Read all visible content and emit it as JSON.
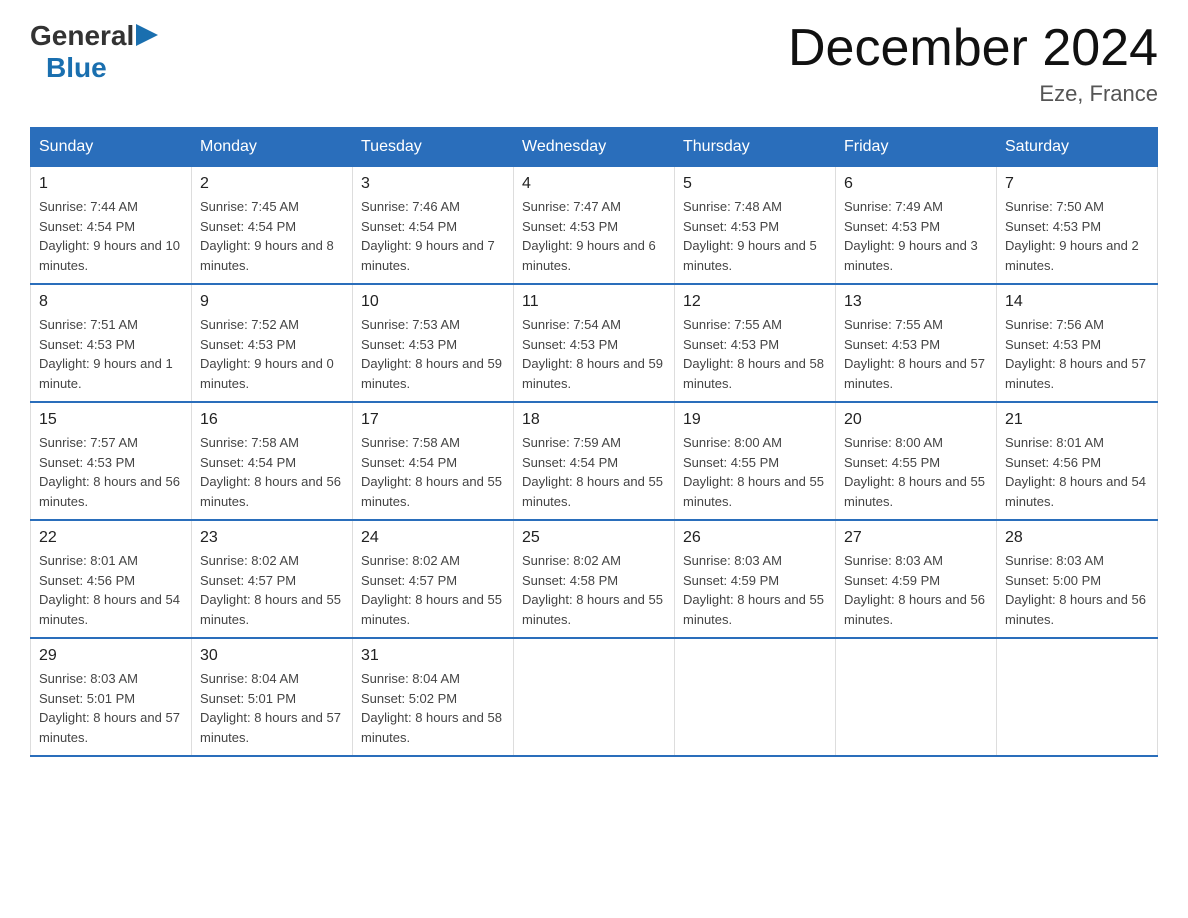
{
  "header": {
    "logo_text_general": "General",
    "logo_text_blue": "Blue",
    "month_title": "December 2024",
    "location": "Eze, France"
  },
  "weekdays": [
    "Sunday",
    "Monday",
    "Tuesday",
    "Wednesday",
    "Thursday",
    "Friday",
    "Saturday"
  ],
  "weeks": [
    [
      {
        "day": "1",
        "sunrise": "7:44 AM",
        "sunset": "4:54 PM",
        "daylight": "9 hours and 10 minutes."
      },
      {
        "day": "2",
        "sunrise": "7:45 AM",
        "sunset": "4:54 PM",
        "daylight": "9 hours and 8 minutes."
      },
      {
        "day": "3",
        "sunrise": "7:46 AM",
        "sunset": "4:54 PM",
        "daylight": "9 hours and 7 minutes."
      },
      {
        "day": "4",
        "sunrise": "7:47 AM",
        "sunset": "4:53 PM",
        "daylight": "9 hours and 6 minutes."
      },
      {
        "day": "5",
        "sunrise": "7:48 AM",
        "sunset": "4:53 PM",
        "daylight": "9 hours and 5 minutes."
      },
      {
        "day": "6",
        "sunrise": "7:49 AM",
        "sunset": "4:53 PM",
        "daylight": "9 hours and 3 minutes."
      },
      {
        "day": "7",
        "sunrise": "7:50 AM",
        "sunset": "4:53 PM",
        "daylight": "9 hours and 2 minutes."
      }
    ],
    [
      {
        "day": "8",
        "sunrise": "7:51 AM",
        "sunset": "4:53 PM",
        "daylight": "9 hours and 1 minute."
      },
      {
        "day": "9",
        "sunrise": "7:52 AM",
        "sunset": "4:53 PM",
        "daylight": "9 hours and 0 minutes."
      },
      {
        "day": "10",
        "sunrise": "7:53 AM",
        "sunset": "4:53 PM",
        "daylight": "8 hours and 59 minutes."
      },
      {
        "day": "11",
        "sunrise": "7:54 AM",
        "sunset": "4:53 PM",
        "daylight": "8 hours and 59 minutes."
      },
      {
        "day": "12",
        "sunrise": "7:55 AM",
        "sunset": "4:53 PM",
        "daylight": "8 hours and 58 minutes."
      },
      {
        "day": "13",
        "sunrise": "7:55 AM",
        "sunset": "4:53 PM",
        "daylight": "8 hours and 57 minutes."
      },
      {
        "day": "14",
        "sunrise": "7:56 AM",
        "sunset": "4:53 PM",
        "daylight": "8 hours and 57 minutes."
      }
    ],
    [
      {
        "day": "15",
        "sunrise": "7:57 AM",
        "sunset": "4:53 PM",
        "daylight": "8 hours and 56 minutes."
      },
      {
        "day": "16",
        "sunrise": "7:58 AM",
        "sunset": "4:54 PM",
        "daylight": "8 hours and 56 minutes."
      },
      {
        "day": "17",
        "sunrise": "7:58 AM",
        "sunset": "4:54 PM",
        "daylight": "8 hours and 55 minutes."
      },
      {
        "day": "18",
        "sunrise": "7:59 AM",
        "sunset": "4:54 PM",
        "daylight": "8 hours and 55 minutes."
      },
      {
        "day": "19",
        "sunrise": "8:00 AM",
        "sunset": "4:55 PM",
        "daylight": "8 hours and 55 minutes."
      },
      {
        "day": "20",
        "sunrise": "8:00 AM",
        "sunset": "4:55 PM",
        "daylight": "8 hours and 55 minutes."
      },
      {
        "day": "21",
        "sunrise": "8:01 AM",
        "sunset": "4:56 PM",
        "daylight": "8 hours and 54 minutes."
      }
    ],
    [
      {
        "day": "22",
        "sunrise": "8:01 AM",
        "sunset": "4:56 PM",
        "daylight": "8 hours and 54 minutes."
      },
      {
        "day": "23",
        "sunrise": "8:02 AM",
        "sunset": "4:57 PM",
        "daylight": "8 hours and 55 minutes."
      },
      {
        "day": "24",
        "sunrise": "8:02 AM",
        "sunset": "4:57 PM",
        "daylight": "8 hours and 55 minutes."
      },
      {
        "day": "25",
        "sunrise": "8:02 AM",
        "sunset": "4:58 PM",
        "daylight": "8 hours and 55 minutes."
      },
      {
        "day": "26",
        "sunrise": "8:03 AM",
        "sunset": "4:59 PM",
        "daylight": "8 hours and 55 minutes."
      },
      {
        "day": "27",
        "sunrise": "8:03 AM",
        "sunset": "4:59 PM",
        "daylight": "8 hours and 56 minutes."
      },
      {
        "day": "28",
        "sunrise": "8:03 AM",
        "sunset": "5:00 PM",
        "daylight": "8 hours and 56 minutes."
      }
    ],
    [
      {
        "day": "29",
        "sunrise": "8:03 AM",
        "sunset": "5:01 PM",
        "daylight": "8 hours and 57 minutes."
      },
      {
        "day": "30",
        "sunrise": "8:04 AM",
        "sunset": "5:01 PM",
        "daylight": "8 hours and 57 minutes."
      },
      {
        "day": "31",
        "sunrise": "8:04 AM",
        "sunset": "5:02 PM",
        "daylight": "8 hours and 58 minutes."
      },
      null,
      null,
      null,
      null
    ]
  ],
  "labels": {
    "sunrise": "Sunrise:",
    "sunset": "Sunset:",
    "daylight": "Daylight:"
  }
}
